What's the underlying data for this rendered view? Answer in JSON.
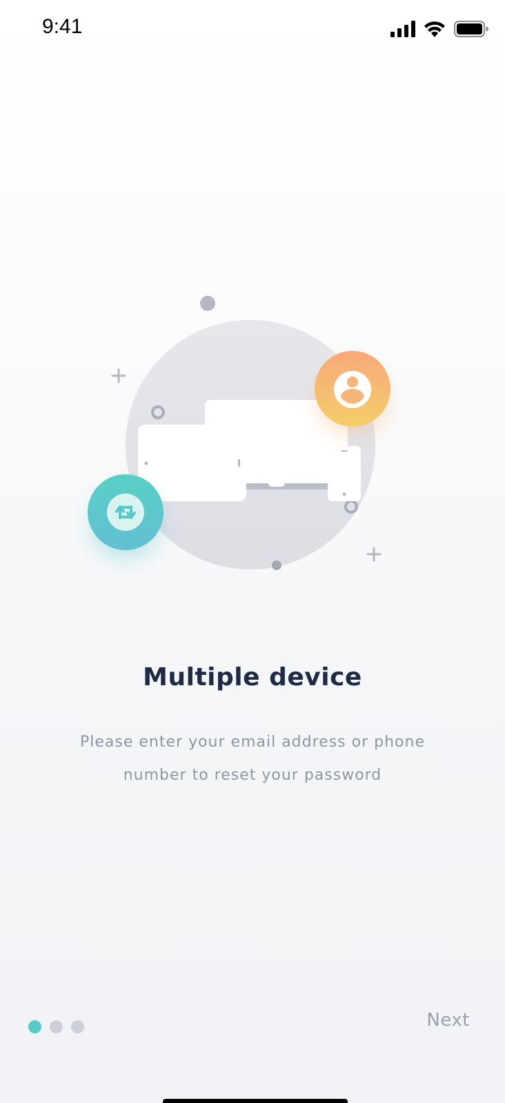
{
  "status_bar": {
    "time": "9:41",
    "icons": [
      "signal-icon",
      "wifi-icon",
      "battery-icon"
    ]
  },
  "illustration": {
    "icons": [
      "laptop-icon",
      "tablet-icon",
      "phone-icon",
      "user-profile-icon",
      "sync-icon"
    ],
    "colors": {
      "sync_badge": "#56c9c8",
      "user_badge": "#f7a87a"
    }
  },
  "onboarding": {
    "title": "Multiple device",
    "description": "Please enter your email address or phone number to reset your password"
  },
  "pagination": {
    "total": 3,
    "current": 1,
    "active_color": "#56c9c8",
    "inactive_color": "#ccd0d6"
  },
  "actions": {
    "next_label": "Next"
  }
}
